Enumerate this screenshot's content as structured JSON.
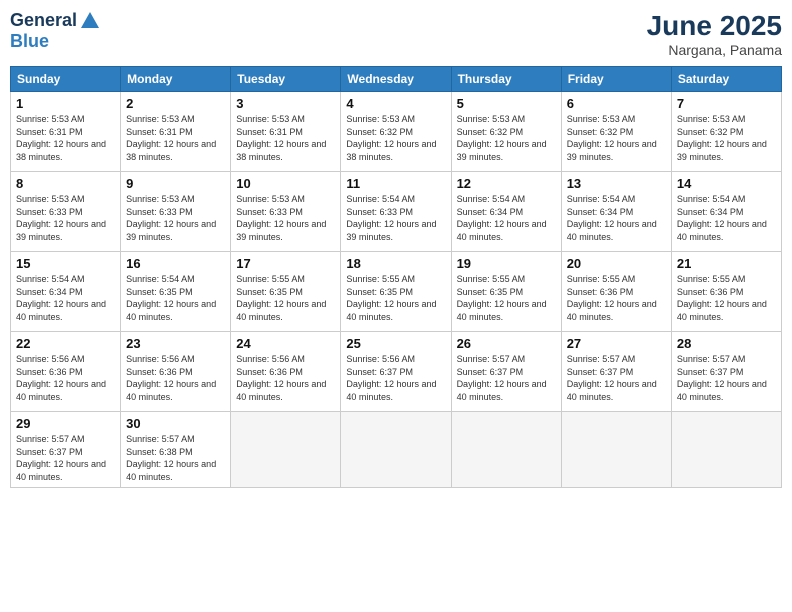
{
  "logo": {
    "line1": "General",
    "line2": "Blue"
  },
  "title": "June 2025",
  "location": "Nargana, Panama",
  "days_of_week": [
    "Sunday",
    "Monday",
    "Tuesday",
    "Wednesday",
    "Thursday",
    "Friday",
    "Saturday"
  ],
  "weeks": [
    [
      {
        "day": "1",
        "sunrise": "5:53 AM",
        "sunset": "6:31 PM",
        "daylight": "12 hours and 38 minutes."
      },
      {
        "day": "2",
        "sunrise": "5:53 AM",
        "sunset": "6:31 PM",
        "daylight": "12 hours and 38 minutes."
      },
      {
        "day": "3",
        "sunrise": "5:53 AM",
        "sunset": "6:31 PM",
        "daylight": "12 hours and 38 minutes."
      },
      {
        "day": "4",
        "sunrise": "5:53 AM",
        "sunset": "6:32 PM",
        "daylight": "12 hours and 38 minutes."
      },
      {
        "day": "5",
        "sunrise": "5:53 AM",
        "sunset": "6:32 PM",
        "daylight": "12 hours and 39 minutes."
      },
      {
        "day": "6",
        "sunrise": "5:53 AM",
        "sunset": "6:32 PM",
        "daylight": "12 hours and 39 minutes."
      },
      {
        "day": "7",
        "sunrise": "5:53 AM",
        "sunset": "6:32 PM",
        "daylight": "12 hours and 39 minutes."
      }
    ],
    [
      {
        "day": "8",
        "sunrise": "5:53 AM",
        "sunset": "6:33 PM",
        "daylight": "12 hours and 39 minutes."
      },
      {
        "day": "9",
        "sunrise": "5:53 AM",
        "sunset": "6:33 PM",
        "daylight": "12 hours and 39 minutes."
      },
      {
        "day": "10",
        "sunrise": "5:53 AM",
        "sunset": "6:33 PM",
        "daylight": "12 hours and 39 minutes."
      },
      {
        "day": "11",
        "sunrise": "5:54 AM",
        "sunset": "6:33 PM",
        "daylight": "12 hours and 39 minutes."
      },
      {
        "day": "12",
        "sunrise": "5:54 AM",
        "sunset": "6:34 PM",
        "daylight": "12 hours and 40 minutes."
      },
      {
        "day": "13",
        "sunrise": "5:54 AM",
        "sunset": "6:34 PM",
        "daylight": "12 hours and 40 minutes."
      },
      {
        "day": "14",
        "sunrise": "5:54 AM",
        "sunset": "6:34 PM",
        "daylight": "12 hours and 40 minutes."
      }
    ],
    [
      {
        "day": "15",
        "sunrise": "5:54 AM",
        "sunset": "6:34 PM",
        "daylight": "12 hours and 40 minutes."
      },
      {
        "day": "16",
        "sunrise": "5:54 AM",
        "sunset": "6:35 PM",
        "daylight": "12 hours and 40 minutes."
      },
      {
        "day": "17",
        "sunrise": "5:55 AM",
        "sunset": "6:35 PM",
        "daylight": "12 hours and 40 minutes."
      },
      {
        "day": "18",
        "sunrise": "5:55 AM",
        "sunset": "6:35 PM",
        "daylight": "12 hours and 40 minutes."
      },
      {
        "day": "19",
        "sunrise": "5:55 AM",
        "sunset": "6:35 PM",
        "daylight": "12 hours and 40 minutes."
      },
      {
        "day": "20",
        "sunrise": "5:55 AM",
        "sunset": "6:36 PM",
        "daylight": "12 hours and 40 minutes."
      },
      {
        "day": "21",
        "sunrise": "5:55 AM",
        "sunset": "6:36 PM",
        "daylight": "12 hours and 40 minutes."
      }
    ],
    [
      {
        "day": "22",
        "sunrise": "5:56 AM",
        "sunset": "6:36 PM",
        "daylight": "12 hours and 40 minutes."
      },
      {
        "day": "23",
        "sunrise": "5:56 AM",
        "sunset": "6:36 PM",
        "daylight": "12 hours and 40 minutes."
      },
      {
        "day": "24",
        "sunrise": "5:56 AM",
        "sunset": "6:36 PM",
        "daylight": "12 hours and 40 minutes."
      },
      {
        "day": "25",
        "sunrise": "5:56 AM",
        "sunset": "6:37 PM",
        "daylight": "12 hours and 40 minutes."
      },
      {
        "day": "26",
        "sunrise": "5:57 AM",
        "sunset": "6:37 PM",
        "daylight": "12 hours and 40 minutes."
      },
      {
        "day": "27",
        "sunrise": "5:57 AM",
        "sunset": "6:37 PM",
        "daylight": "12 hours and 40 minutes."
      },
      {
        "day": "28",
        "sunrise": "5:57 AM",
        "sunset": "6:37 PM",
        "daylight": "12 hours and 40 minutes."
      }
    ],
    [
      {
        "day": "29",
        "sunrise": "5:57 AM",
        "sunset": "6:37 PM",
        "daylight": "12 hours and 40 minutes."
      },
      {
        "day": "30",
        "sunrise": "5:57 AM",
        "sunset": "6:38 PM",
        "daylight": "12 hours and 40 minutes."
      },
      null,
      null,
      null,
      null,
      null
    ]
  ]
}
